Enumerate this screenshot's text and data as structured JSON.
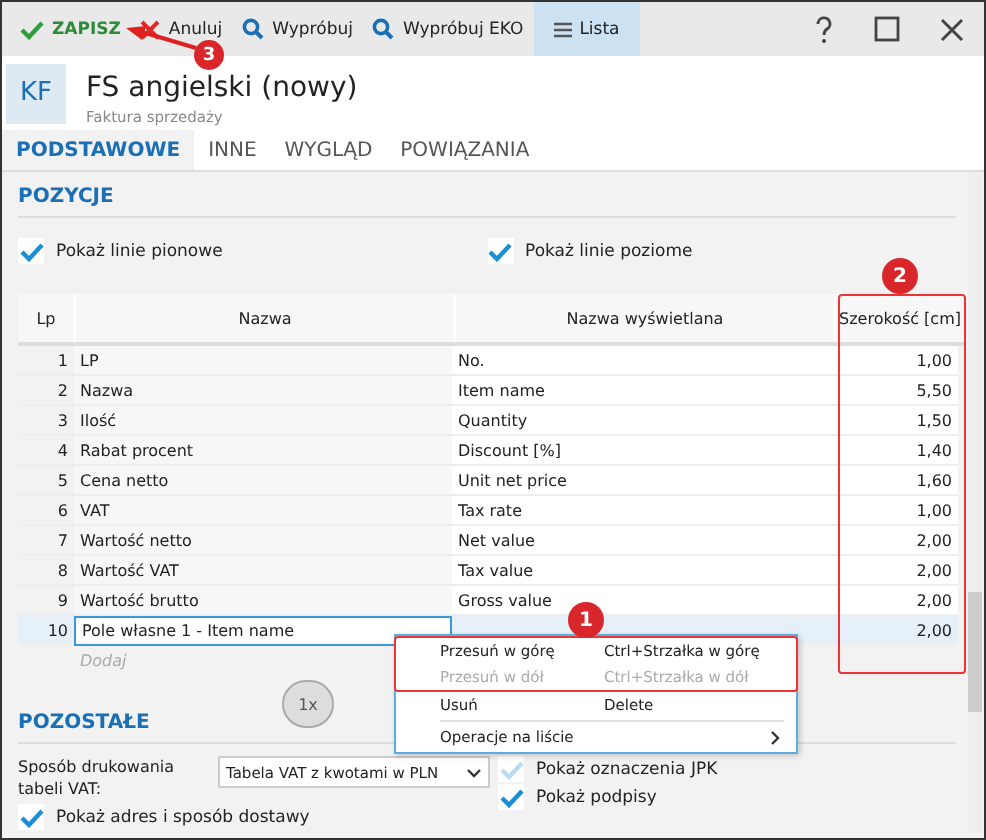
{
  "toolbar": [
    {
      "label": "ZAPISZ",
      "kind": "save"
    },
    {
      "label": "Anuluj",
      "kind": "cancel"
    },
    {
      "label": "Wypróbuj",
      "kind": "search"
    },
    {
      "label": "Wypróbuj EKO",
      "kind": "search"
    },
    {
      "label": "Lista",
      "kind": "list",
      "selected": true
    }
  ],
  "header": {
    "badge": "KF",
    "title": "FS angielski (nowy)",
    "subtitle": "Faktura sprzedaży"
  },
  "tabs": [
    {
      "label": "PODSTAWOWE",
      "selected": true
    },
    {
      "label": "INNE",
      "selected": false
    },
    {
      "label": "WYGLĄD",
      "selected": false
    },
    {
      "label": "POWIĄZANIA",
      "selected": false
    }
  ],
  "pozycje": {
    "title": "POZYCJE",
    "options": [
      {
        "label": "Pokaż linie pionowe",
        "checked": true
      },
      {
        "label": "Pokaż linie poziome",
        "checked": true
      }
    ]
  },
  "table": {
    "columns": [
      "Lp",
      "Nazwa",
      "Nazwa wyświetlana",
      "Szerokość [cm]"
    ],
    "rows": [
      {
        "cells": [
          "1",
          "LP",
          "No.",
          "1,00"
        ],
        "selected": false
      },
      {
        "cells": [
          "2",
          "Nazwa",
          "Item name",
          "5,50"
        ],
        "selected": false
      },
      {
        "cells": [
          "3",
          "Ilość",
          "Quantity",
          "1,50"
        ],
        "selected": false
      },
      {
        "cells": [
          "4",
          "Rabat procent",
          "Discount [%]",
          "1,40"
        ],
        "selected": false
      },
      {
        "cells": [
          "5",
          "Cena netto",
          "Unit net price",
          "1,60"
        ],
        "selected": false
      },
      {
        "cells": [
          "6",
          "VAT",
          "Tax rate",
          "1,00"
        ],
        "selected": false
      },
      {
        "cells": [
          "7",
          "Wartość netto",
          "Net value",
          "2,00"
        ],
        "selected": false
      },
      {
        "cells": [
          "8",
          "Wartość VAT",
          "Tax value",
          "2,00"
        ],
        "selected": false
      },
      {
        "cells": [
          "9",
          "Wartość brutto",
          "Gross value",
          "2,00"
        ],
        "selected": false
      },
      {
        "cells": [
          "10",
          "Pole własne 1 - Item name",
          "",
          "2,00"
        ],
        "selected": true
      }
    ],
    "add_placeholder": "Dodaj"
  },
  "context_menu": [
    {
      "label": "Przesuń w górę",
      "shortcut": "Ctrl+Strzałka w górę",
      "disabled": false,
      "kind": "item",
      "highlighted": true
    },
    {
      "label": "Przesuń w dół",
      "shortcut": "Ctrl+Strzałka w dół",
      "disabled": true,
      "kind": "item",
      "highlighted": true
    },
    {
      "label": "Usuń",
      "shortcut": "Delete",
      "disabled": false,
      "kind": "item",
      "highlighted": false
    },
    {
      "label": "Operacje na liście",
      "disabled": false,
      "kind": "submenu",
      "highlighted": false
    }
  ],
  "callouts": [
    "1",
    "2",
    "3"
  ],
  "mouse_hint": "1x",
  "pozostale": {
    "title": "POZOSTAŁE",
    "select_label": "Sposób drukowania tabeli VAT:",
    "select_value": "Tabela VAT z kwotami w PLN",
    "left_options": [
      {
        "label": "Pokaż adres i sposób dostawy",
        "checked": true,
        "disabled": false
      }
    ],
    "right_options": [
      {
        "label": "Pokaż oznaczenia JPK",
        "checked": true,
        "disabled": true
      },
      {
        "label": "Pokaż podpisy",
        "checked": true,
        "disabled": false
      }
    ]
  }
}
